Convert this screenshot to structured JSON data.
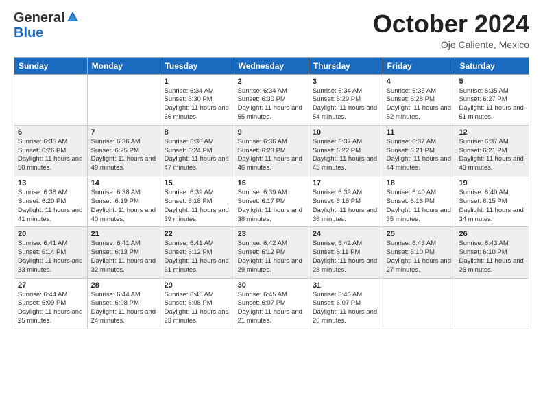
{
  "logo": {
    "general": "General",
    "blue": "Blue"
  },
  "header": {
    "month": "October 2024",
    "location": "Ojo Caliente, Mexico"
  },
  "days_of_week": [
    "Sunday",
    "Monday",
    "Tuesday",
    "Wednesday",
    "Thursday",
    "Friday",
    "Saturday"
  ],
  "weeks": [
    [
      {
        "day": "",
        "info": ""
      },
      {
        "day": "",
        "info": ""
      },
      {
        "day": "1",
        "info": "Sunrise: 6:34 AM\nSunset: 6:30 PM\nDaylight: 11 hours and 56 minutes."
      },
      {
        "day": "2",
        "info": "Sunrise: 6:34 AM\nSunset: 6:30 PM\nDaylight: 11 hours and 55 minutes."
      },
      {
        "day": "3",
        "info": "Sunrise: 6:34 AM\nSunset: 6:29 PM\nDaylight: 11 hours and 54 minutes."
      },
      {
        "day": "4",
        "info": "Sunrise: 6:35 AM\nSunset: 6:28 PM\nDaylight: 11 hours and 52 minutes."
      },
      {
        "day": "5",
        "info": "Sunrise: 6:35 AM\nSunset: 6:27 PM\nDaylight: 11 hours and 51 minutes."
      }
    ],
    [
      {
        "day": "6",
        "info": "Sunrise: 6:35 AM\nSunset: 6:26 PM\nDaylight: 11 hours and 50 minutes."
      },
      {
        "day": "7",
        "info": "Sunrise: 6:36 AM\nSunset: 6:25 PM\nDaylight: 11 hours and 49 minutes."
      },
      {
        "day": "8",
        "info": "Sunrise: 6:36 AM\nSunset: 6:24 PM\nDaylight: 11 hours and 47 minutes."
      },
      {
        "day": "9",
        "info": "Sunrise: 6:36 AM\nSunset: 6:23 PM\nDaylight: 11 hours and 46 minutes."
      },
      {
        "day": "10",
        "info": "Sunrise: 6:37 AM\nSunset: 6:22 PM\nDaylight: 11 hours and 45 minutes."
      },
      {
        "day": "11",
        "info": "Sunrise: 6:37 AM\nSunset: 6:21 PM\nDaylight: 11 hours and 44 minutes."
      },
      {
        "day": "12",
        "info": "Sunrise: 6:37 AM\nSunset: 6:21 PM\nDaylight: 11 hours and 43 minutes."
      }
    ],
    [
      {
        "day": "13",
        "info": "Sunrise: 6:38 AM\nSunset: 6:20 PM\nDaylight: 11 hours and 41 minutes."
      },
      {
        "day": "14",
        "info": "Sunrise: 6:38 AM\nSunset: 6:19 PM\nDaylight: 11 hours and 40 minutes."
      },
      {
        "day": "15",
        "info": "Sunrise: 6:39 AM\nSunset: 6:18 PM\nDaylight: 11 hours and 39 minutes."
      },
      {
        "day": "16",
        "info": "Sunrise: 6:39 AM\nSunset: 6:17 PM\nDaylight: 11 hours and 38 minutes."
      },
      {
        "day": "17",
        "info": "Sunrise: 6:39 AM\nSunset: 6:16 PM\nDaylight: 11 hours and 36 minutes."
      },
      {
        "day": "18",
        "info": "Sunrise: 6:40 AM\nSunset: 6:16 PM\nDaylight: 11 hours and 35 minutes."
      },
      {
        "day": "19",
        "info": "Sunrise: 6:40 AM\nSunset: 6:15 PM\nDaylight: 11 hours and 34 minutes."
      }
    ],
    [
      {
        "day": "20",
        "info": "Sunrise: 6:41 AM\nSunset: 6:14 PM\nDaylight: 11 hours and 33 minutes."
      },
      {
        "day": "21",
        "info": "Sunrise: 6:41 AM\nSunset: 6:13 PM\nDaylight: 11 hours and 32 minutes."
      },
      {
        "day": "22",
        "info": "Sunrise: 6:41 AM\nSunset: 6:12 PM\nDaylight: 11 hours and 31 minutes."
      },
      {
        "day": "23",
        "info": "Sunrise: 6:42 AM\nSunset: 6:12 PM\nDaylight: 11 hours and 29 minutes."
      },
      {
        "day": "24",
        "info": "Sunrise: 6:42 AM\nSunset: 6:11 PM\nDaylight: 11 hours and 28 minutes."
      },
      {
        "day": "25",
        "info": "Sunrise: 6:43 AM\nSunset: 6:10 PM\nDaylight: 11 hours and 27 minutes."
      },
      {
        "day": "26",
        "info": "Sunrise: 6:43 AM\nSunset: 6:10 PM\nDaylight: 11 hours and 26 minutes."
      }
    ],
    [
      {
        "day": "27",
        "info": "Sunrise: 6:44 AM\nSunset: 6:09 PM\nDaylight: 11 hours and 25 minutes."
      },
      {
        "day": "28",
        "info": "Sunrise: 6:44 AM\nSunset: 6:08 PM\nDaylight: 11 hours and 24 minutes."
      },
      {
        "day": "29",
        "info": "Sunrise: 6:45 AM\nSunset: 6:08 PM\nDaylight: 11 hours and 23 minutes."
      },
      {
        "day": "30",
        "info": "Sunrise: 6:45 AM\nSunset: 6:07 PM\nDaylight: 11 hours and 21 minutes."
      },
      {
        "day": "31",
        "info": "Sunrise: 6:46 AM\nSunset: 6:07 PM\nDaylight: 11 hours and 20 minutes."
      },
      {
        "day": "",
        "info": ""
      },
      {
        "day": "",
        "info": ""
      }
    ]
  ]
}
